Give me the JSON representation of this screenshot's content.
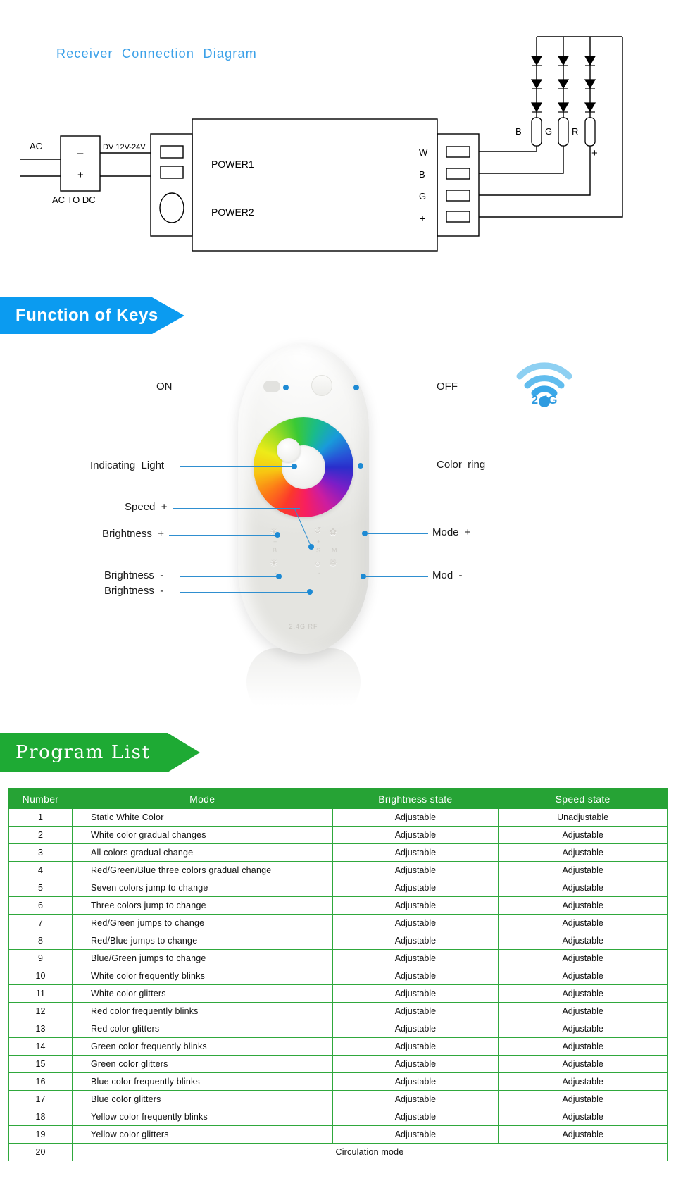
{
  "wiring": {
    "title": "Receiver  Connection  Diagram",
    "ac_label": "AC",
    "converter_label": "AC  TO  DC",
    "converter_minus": "–",
    "converter_plus": "+",
    "dc_label": "DV  12V-24V",
    "power1_label": "POWER1",
    "power2_label": "POWER2",
    "output_terminals": [
      "W",
      "B",
      "G",
      "+"
    ],
    "led_strip_labels": [
      "B",
      "G",
      "R"
    ],
    "strip_plus": "+"
  },
  "keys": {
    "banner": "Function of Keys",
    "wifi_label": "2.4G",
    "remote_footer": "2.4G RF",
    "left_callouts": [
      {
        "label": "ON"
      },
      {
        "label": "Indicating  Light"
      },
      {
        "label": "Speed  +"
      },
      {
        "label": "Brightness  +"
      },
      {
        "label": "Brightness  -"
      },
      {
        "label": "Brightness  -"
      }
    ],
    "right_callouts": [
      {
        "label": "OFF"
      },
      {
        "label": "Color  ring"
      },
      {
        "label": "Mode  +"
      },
      {
        "label": "Mod  -"
      }
    ],
    "key_glyphs": {
      "brightness_up": "☀",
      "brightness_down": "☀",
      "speed_up": "↺",
      "speed_down": "○",
      "speed_letter": "S",
      "brightness_letter": "B",
      "mode_letter": "M",
      "mode_up": "✿",
      "mode_down": "❁",
      "plus": "+",
      "minus": "-"
    }
  },
  "program": {
    "banner": "Program List",
    "columns": [
      "Number",
      "Mode",
      "Brightness state",
      "Speed state"
    ],
    "rows": [
      {
        "number": "1",
        "mode": "Static White Color",
        "brightness": "Adjustable",
        "speed": "Unadjustable"
      },
      {
        "number": "2",
        "mode": "White color  gradual  changes",
        "brightness": "Adjustable",
        "speed": "Adjustable"
      },
      {
        "number": "3",
        "mode": "All  colors  gradual  change",
        "brightness": "Adjustable",
        "speed": "Adjustable"
      },
      {
        "number": "4",
        "mode": "Red/Green/Blue  three  colors  gradual  change",
        "brightness": "Adjustable",
        "speed": "Adjustable"
      },
      {
        "number": "5",
        "mode": "Seven  colors  jump  to  change",
        "brightness": "Adjustable",
        "speed": "Adjustable"
      },
      {
        "number": "6",
        "mode": "Three  colors  jump  to  change",
        "brightness": "Adjustable",
        "speed": "Adjustable"
      },
      {
        "number": "7",
        "mode": "Red/Green  jumps  to  change",
        "brightness": "Adjustable",
        "speed": "Adjustable"
      },
      {
        "number": "8",
        "mode": "Red/Blue  jumps  to  change",
        "brightness": "Adjustable",
        "speed": "Adjustable"
      },
      {
        "number": "9",
        "mode": "Blue/Green  jumps  to  change",
        "brightness": "Adjustable",
        "speed": "Adjustable"
      },
      {
        "number": "10",
        "mode": "White  color  frequently  blinks",
        "brightness": "Adjustable",
        "speed": "Adjustable"
      },
      {
        "number": "11",
        "mode": "White  color  glitters",
        "brightness": "Adjustable",
        "speed": "Adjustable"
      },
      {
        "number": "12",
        "mode": "Red  color  frequently  blinks",
        "brightness": "Adjustable",
        "speed": "Adjustable"
      },
      {
        "number": "13",
        "mode": "Red  color  glitters",
        "brightness": "Adjustable",
        "speed": "Adjustable"
      },
      {
        "number": "14",
        "mode": "Green  color  frequently  blinks",
        "brightness": "Adjustable",
        "speed": "Adjustable"
      },
      {
        "number": "15",
        "mode": "Green  color  glitters",
        "brightness": "Adjustable",
        "speed": "Adjustable"
      },
      {
        "number": "16",
        "mode": "Blue  color  frequently  blinks",
        "brightness": "Adjustable",
        "speed": "Adjustable"
      },
      {
        "number": "17",
        "mode": "Blue  color  glitters",
        "brightness": "Adjustable",
        "speed": "Adjustable"
      },
      {
        "number": "18",
        "mode": "Yellow  color  frequently  blinks",
        "brightness": "Adjustable",
        "speed": "Adjustable"
      },
      {
        "number": "19",
        "mode": "Yellow  color  glitters",
        "brightness": "Adjustable",
        "speed": "Adjustable"
      },
      {
        "number": "20",
        "mode": "Circulation  mode",
        "brightness": "",
        "speed": "",
        "merged": true
      }
    ]
  },
  "colors": {
    "title_blue": "#3aa0e8",
    "banner_blue": "#0b9bf0",
    "banner_green": "#1eaa34",
    "table_header_green": "#26a335",
    "table_border_green": "#2fa83c",
    "callout_blue": "#1d8ad4"
  }
}
